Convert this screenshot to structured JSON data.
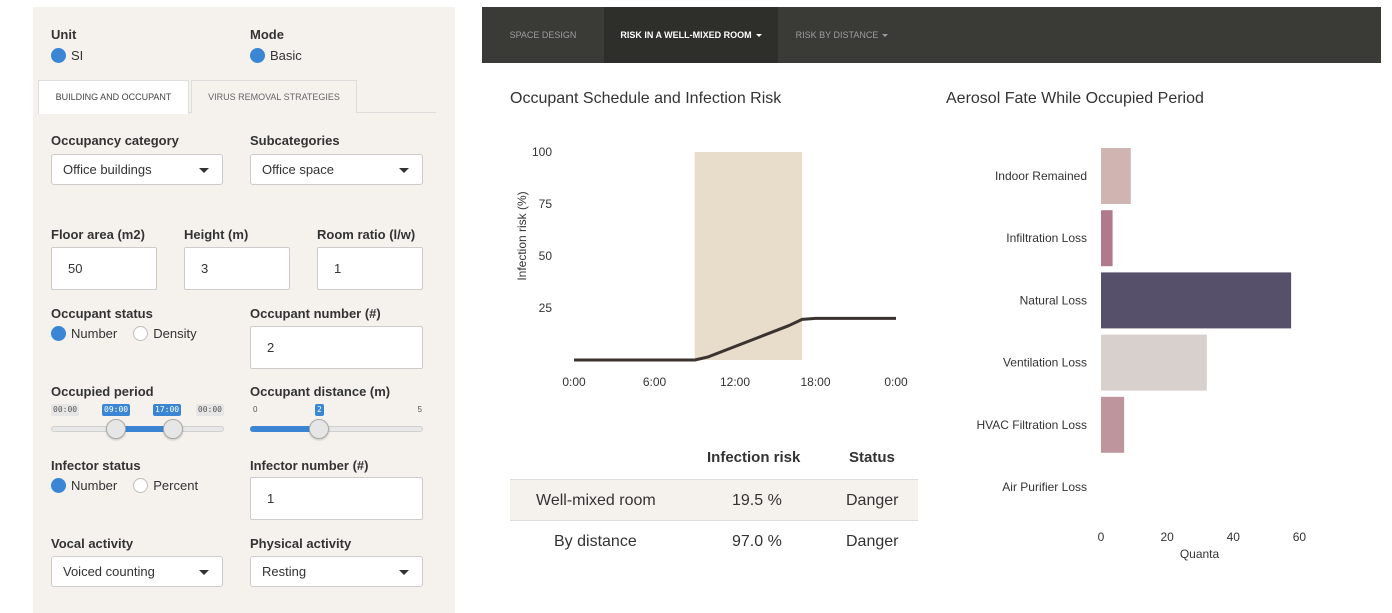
{
  "sidebar": {
    "unit": {
      "label": "Unit",
      "option": "SI"
    },
    "mode": {
      "label": "Mode",
      "option": "Basic"
    },
    "tabs": [
      {
        "label": "BUILDING AND OCCUPANT"
      },
      {
        "label": "VIRUS REMOVAL STRATEGIES"
      }
    ],
    "occupancy_category": {
      "label": "Occupancy category",
      "value": "Office buildings"
    },
    "subcategories": {
      "label": "Subcategories",
      "value": "Office space"
    },
    "floor_area": {
      "label": "Floor area (m2)",
      "value": "50"
    },
    "height": {
      "label": "Height (m)",
      "value": "3"
    },
    "room_ratio": {
      "label": "Room ratio (l/w)",
      "value": "1"
    },
    "occupant_status": {
      "label": "Occupant status",
      "options": [
        "Number",
        "Density"
      ]
    },
    "occupant_number": {
      "label": "Occupant number (#)",
      "value": "2"
    },
    "occupied_period": {
      "label": "Occupied period",
      "min": "00:00",
      "from": "09:00",
      "to": "17:00",
      "max": "00:00",
      "from_fraction": 0.375,
      "to_fraction": 0.708
    },
    "occupant_distance": {
      "label": "Occupant distance (m)",
      "min": "0",
      "value": "2",
      "max": "5",
      "value_fraction": 0.4
    },
    "infector_status": {
      "label": "Infector status",
      "options": [
        "Number",
        "Percent"
      ]
    },
    "infector_number": {
      "label": "Infector number (#)",
      "value": "1"
    },
    "vocal_activity": {
      "label": "Vocal activity",
      "value": "Voiced counting"
    },
    "physical_activity": {
      "label": "Physical activity",
      "value": "Resting"
    }
  },
  "nav": {
    "items": [
      {
        "label": "SPACE DESIGN"
      },
      {
        "label": "RISK IN A WELL-MIXED ROOM"
      },
      {
        "label": "RISK BY DISTANCE"
      }
    ]
  },
  "schedule": {
    "title": "Occupant Schedule and Infection Risk"
  },
  "aerosol": {
    "title": "Aerosol Fate While Occupied Period"
  },
  "risk_table": {
    "headers": [
      "",
      "Infection risk",
      "Status"
    ],
    "rows": [
      {
        "name": "Well-mixed room",
        "risk": "19.5 %",
        "status": "Danger"
      },
      {
        "name": "By distance",
        "risk": "97.0 %",
        "status": "Danger"
      }
    ]
  },
  "colors": {
    "accent": "#3a86d4",
    "navbar": "#3a3a36",
    "occupied_band": "#e8dccb",
    "risk_line": "#3b3330",
    "bar_colors": [
      "#cfb4b1",
      "#b0798c",
      "#57506a",
      "#d8d0cc",
      "#bf959d",
      "#ffffff"
    ]
  },
  "chart_data": [
    {
      "type": "line",
      "title": "",
      "xlabel": "",
      "ylabel": "Infection risk (%)",
      "x_ticks": [
        "0:00",
        "6:00",
        "12:00",
        "18:00",
        "0:00"
      ],
      "y_ticks": [
        25,
        50,
        75,
        100
      ],
      "xlim": [
        0,
        24
      ],
      "ylim": [
        0,
        100
      ],
      "occupied_band": [
        9,
        17
      ],
      "series": [
        {
          "x": [
            0,
            9,
            10,
            12,
            14,
            16,
            17,
            18,
            20,
            24
          ],
          "y": [
            0,
            0,
            1.5,
            6.5,
            11.5,
            16.5,
            19.5,
            20,
            20,
            20
          ]
        }
      ],
      "grid": false
    },
    {
      "type": "bar",
      "orientation": "horizontal",
      "title": "",
      "xlabel": "Quanta",
      "ylabel": "",
      "categories": [
        "Indoor Remained",
        "Infiltration Loss",
        "Natural Loss",
        "Ventilation Loss",
        "HVAC Filtration Loss",
        "Air Purifier Loss"
      ],
      "values": [
        9,
        3.5,
        57.5,
        32,
        7,
        0
      ],
      "xlim": [
        0,
        62
      ],
      "x_ticks": [
        0,
        20,
        40,
        60
      ],
      "grid": false
    }
  ]
}
